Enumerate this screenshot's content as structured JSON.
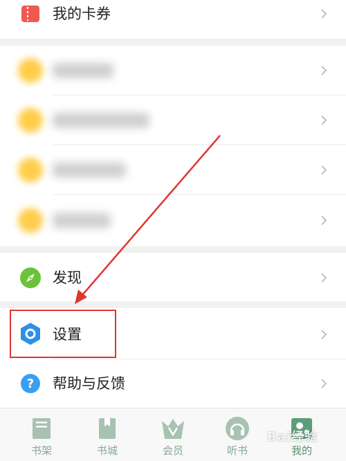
{
  "menu": {
    "coupons_label": "我的卡券",
    "discover_label": "发现",
    "settings_label": "设置",
    "help_label": "帮助与反馈"
  },
  "tabbar": {
    "items": [
      {
        "label": "书架",
        "icon": "bookshelf-icon"
      },
      {
        "label": "书城",
        "icon": "bookstore-icon"
      },
      {
        "label": "会员",
        "icon": "crown-icon"
      },
      {
        "label": "听书",
        "icon": "headphones-icon"
      },
      {
        "label": "我的",
        "icon": "profile-icon"
      }
    ],
    "active": "我的"
  },
  "watermark": "Bai经验",
  "colors": {
    "coupon_icon": "#ee5a52",
    "discover_icon": "#6cc339",
    "settings_icon": "#2e8fe6",
    "help_icon": "#3a9ff0",
    "annotation_red": "#e0352f",
    "tab_green": "#86a893"
  }
}
